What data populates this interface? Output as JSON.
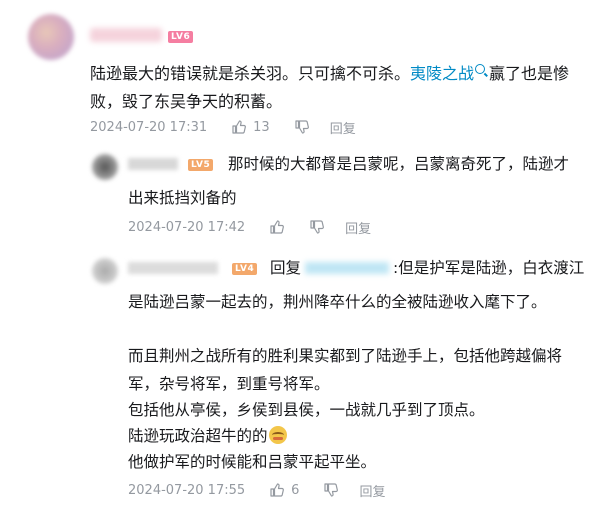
{
  "main_comment": {
    "level": "LV6",
    "text_before_link": "陆逊最大的错误就是杀关羽。只可擒不可杀。",
    "link_text": "夷陵之战",
    "text_after_link": "赢了也是惨",
    "line2": "败，毁了东吴争天的积蓄。",
    "date": "2024-07-20 17:31",
    "likes": "13",
    "reply_label": "回复"
  },
  "reply1": {
    "level": "LV5",
    "line1": "那时候的大都督是吕蒙呢，吕蒙离奇死了，陆逊才",
    "line2": "出来抵挡刘备的",
    "date": "2024-07-20 17:42",
    "reply_label": "回复"
  },
  "reply2": {
    "level": "LV4",
    "reply_prefix": "回复",
    "line1_tail": ":但是护军是陆逊，白衣渡江",
    "line2": "是陆逊吕蒙一起去的，荆州降卒什么的全被陆逊收入麾下了。",
    "line3": "而且荆州之战所有的胜利果实都到了陆逊手上，包括他跨越偏将",
    "line4": "军，杂号将军，到重号将军。",
    "line5": "包括他从亭侯，乡侯到县侯，一战就几乎到了顶点。",
    "line6": "陆逊玩政治超牛的的",
    "line7": "他做护军的时候能和吕蒙平起平坐。",
    "date": "2024-07-20 17:55",
    "likes": "6",
    "reply_label": "回复"
  }
}
